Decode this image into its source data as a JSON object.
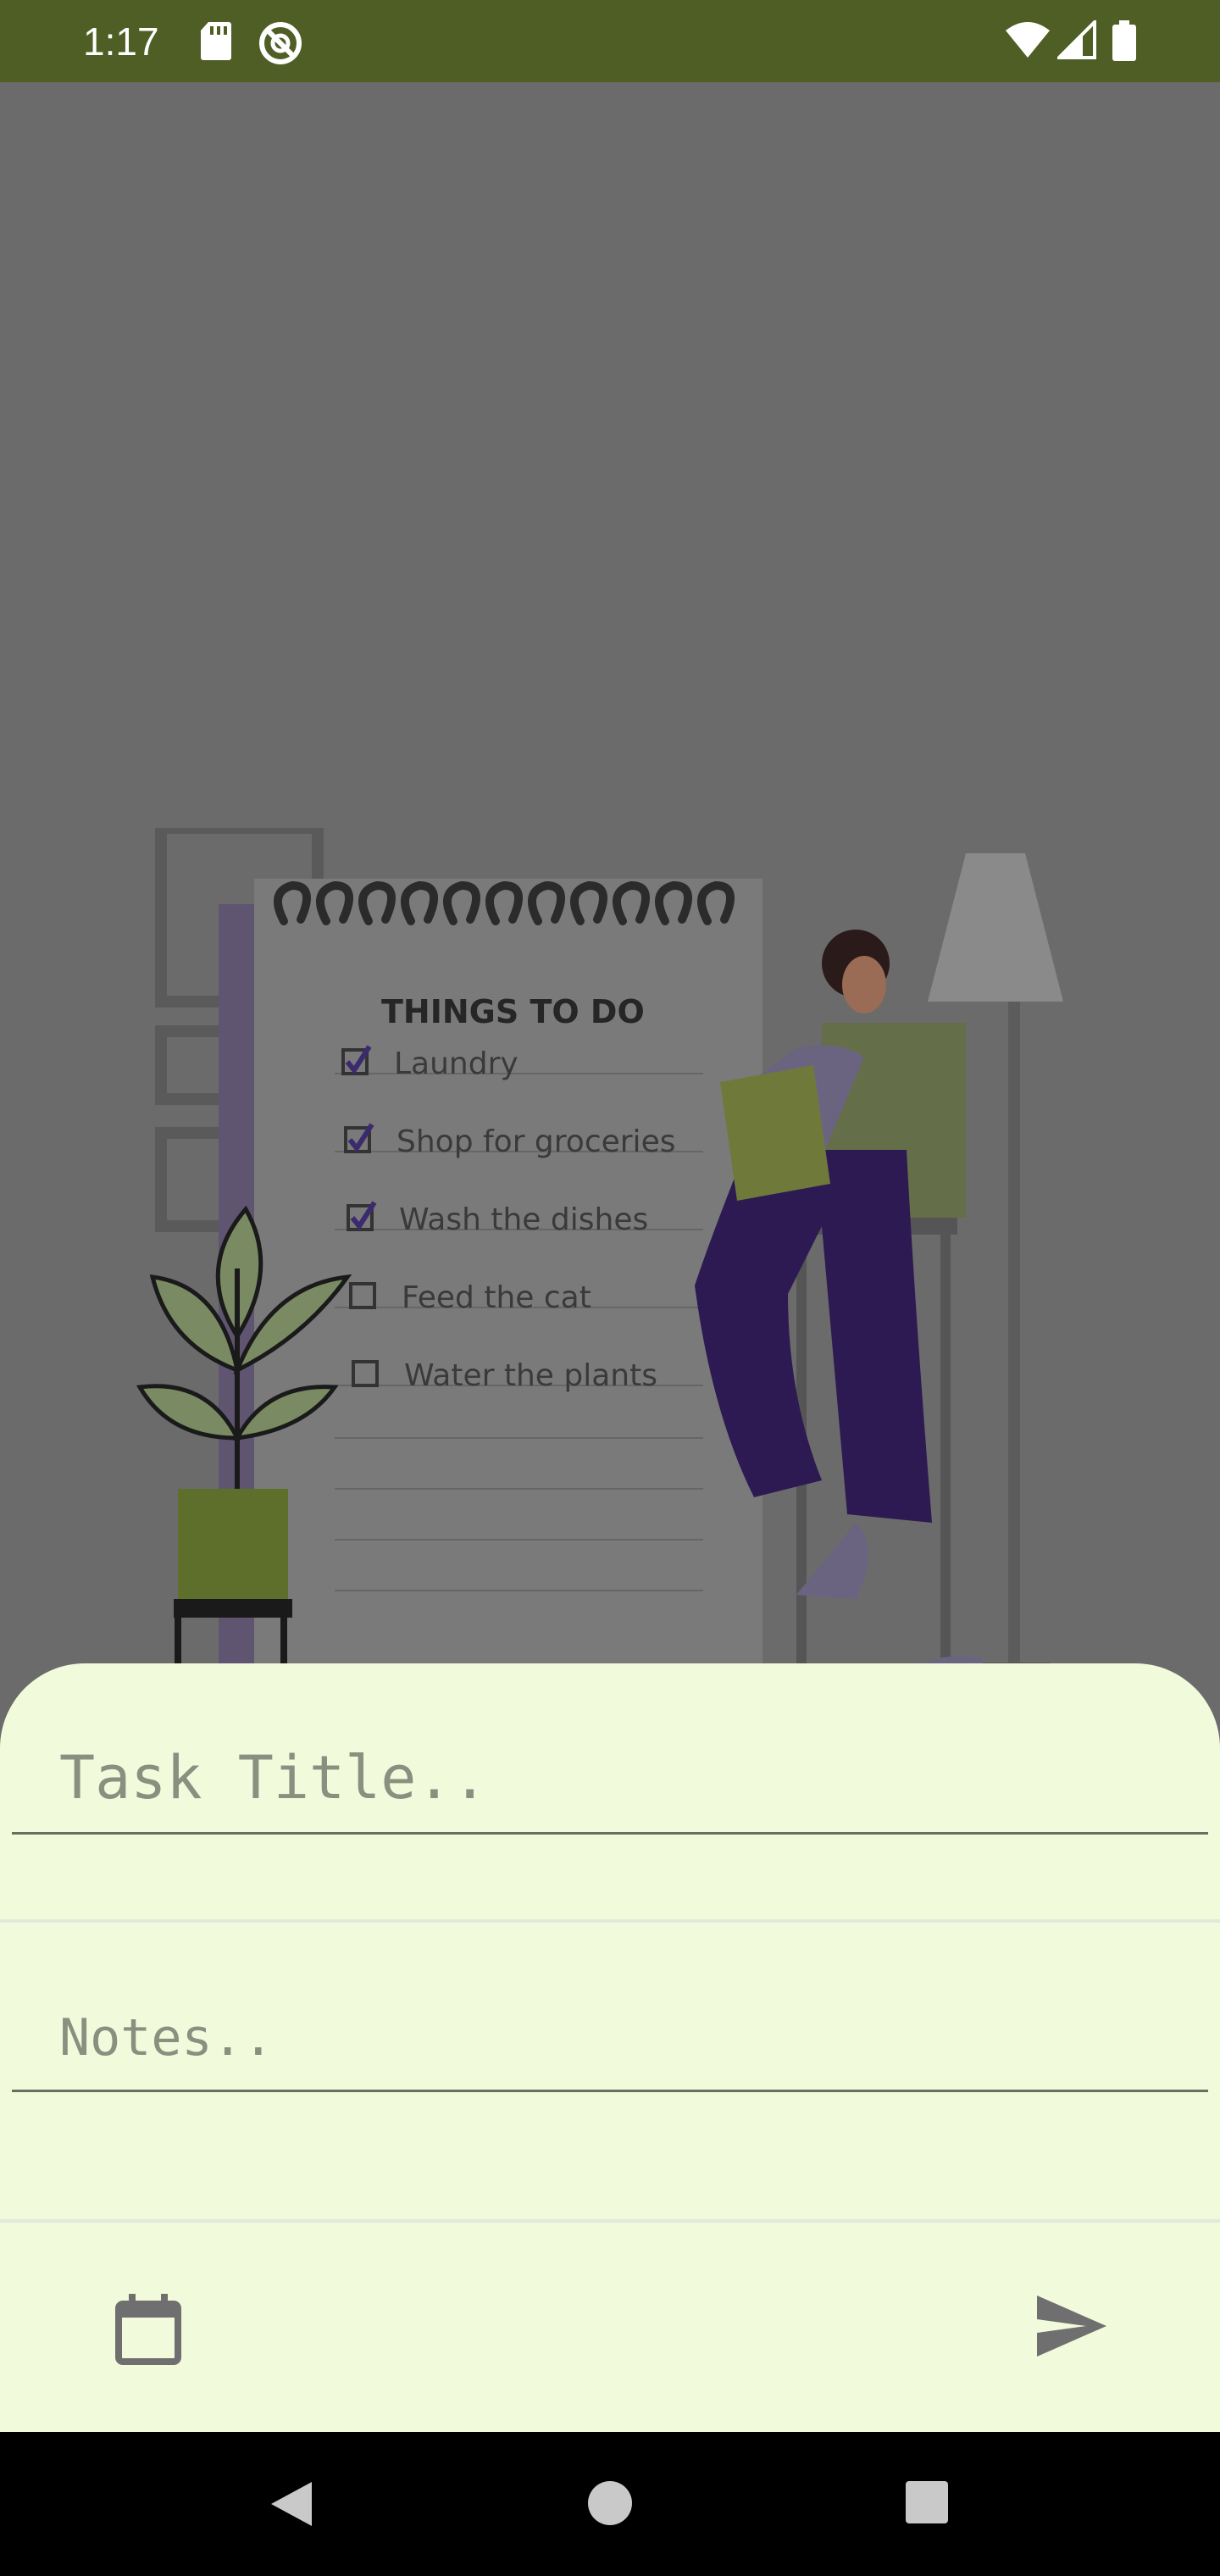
{
  "status_bar": {
    "time": "1:17",
    "background": "#4e5e24",
    "icons": [
      "sd-card-icon",
      "do-not-disturb-icon",
      "wifi-icon",
      "cellular-signal-icon",
      "battery-icon"
    ]
  },
  "illustration": {
    "heading": "THINGS TO DO",
    "items": [
      {
        "label": "Laundry",
        "checked": true
      },
      {
        "label": "Shop for groceries",
        "checked": true
      },
      {
        "label": "Wash the dishes",
        "checked": true
      },
      {
        "label": "Feed the cat",
        "checked": false
      },
      {
        "label": "Water the plants",
        "checked": false
      }
    ]
  },
  "sheet": {
    "background": "#f1fadb",
    "title_placeholder": "Task Title..",
    "title_value": "",
    "notes_placeholder": "Notes..",
    "notes_value": "",
    "icons": {
      "calendar": "calendar-icon",
      "send": "send-icon"
    }
  },
  "nav_bar": {
    "icons": [
      "back-icon",
      "home-icon",
      "recents-icon"
    ]
  }
}
